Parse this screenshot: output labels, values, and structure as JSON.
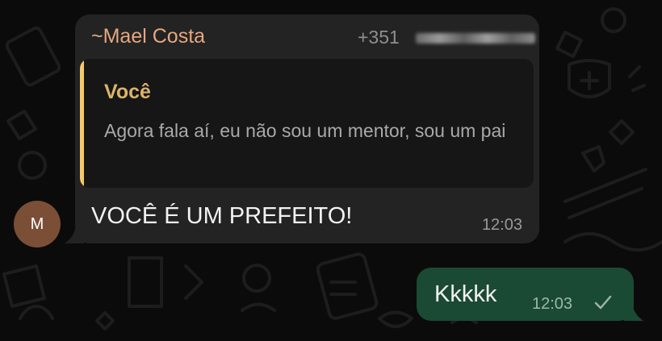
{
  "conversation": {
    "incoming": {
      "avatar_initial": "M",
      "sender_name": "~Mael Costa",
      "sender_phone": "+351",
      "quote": {
        "author": "Você",
        "text": "Agora fala aí, eu não sou um mentor, sou um pai"
      },
      "text": "VOCÊ É UM PREFEITO!",
      "time": "12:03"
    },
    "outgoing": {
      "text": "Kkkkk",
      "time": "12:03",
      "status_icon": "check-icon"
    }
  },
  "colors": {
    "background": "#0b0b0b",
    "incoming_bubble": "#232323",
    "outgoing_bubble": "#1b4a34",
    "sender_name": "#e6a77f",
    "quote_accent": "#f3c96b",
    "avatar": "#7a4f36"
  }
}
